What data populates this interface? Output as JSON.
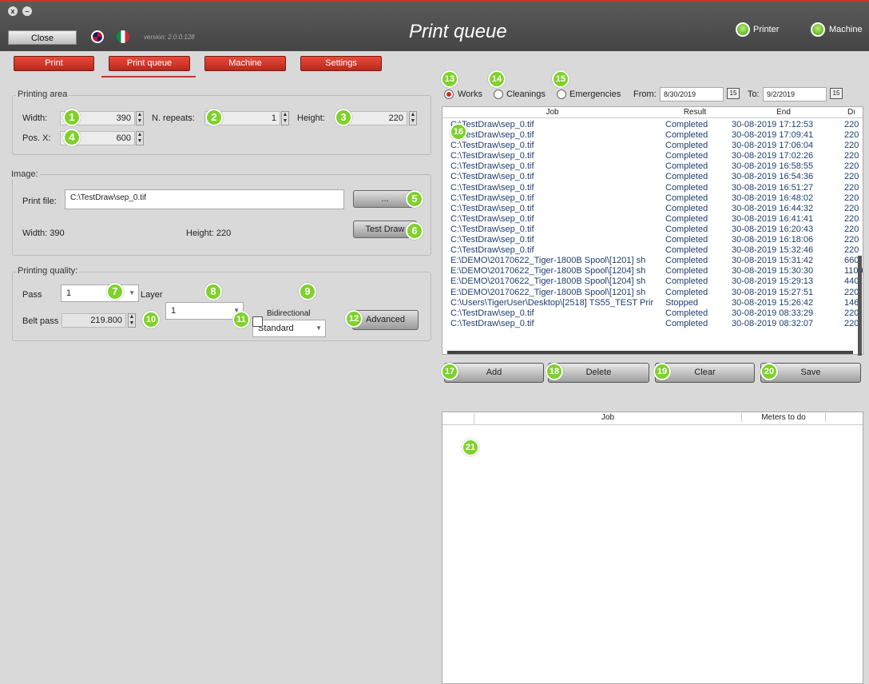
{
  "window": {
    "title": "Print queue",
    "version": "version: 2.0.0.128",
    "close_label": "Close",
    "win_close_glyph": "x",
    "win_min_glyph": "–"
  },
  "status": {
    "printer_label": "Printer",
    "machine_label": "Machine",
    "ok_color": "#7fd12b"
  },
  "nav": {
    "tabs": [
      {
        "label": "Print"
      },
      {
        "label": "Print queue"
      },
      {
        "label": "Machine"
      },
      {
        "label": "Settings"
      }
    ],
    "active": "Print queue"
  },
  "printing_area": {
    "title": "Printing area",
    "width_label": "Width:",
    "width_value": "390",
    "repeats_label": "N. repeats:",
    "repeats_value": "1",
    "height_label": "Height:",
    "height_value": "220",
    "posx_label": "Pos. X:",
    "posx_value": "600"
  },
  "image": {
    "title": "Image:",
    "print_file_label": "Print file:",
    "print_file_value": "C:\\TestDraw\\sep_0.tif",
    "browse_label": "...",
    "width_label": "Width: 390",
    "height_label": "Height: 220",
    "test_draw_label": "Test Draw"
  },
  "quality": {
    "title": "Printing quality:",
    "pass_label": "Pass",
    "pass_value": "1",
    "layer_label": "Layer",
    "layer_value": "1",
    "mode_value": "Standard",
    "belt_label": "Belt pass",
    "belt_value": "219.800",
    "bidir_label": "Bidirectional",
    "advanced_label": "Advanced"
  },
  "filter": {
    "works": "Works",
    "cleanings": "Cleanings",
    "emergencies": "Emergencies",
    "from_label": "From:",
    "from_value": "8/30/2019",
    "to_label": "To:",
    "to_value": "9/2/2019",
    "cal_glyph": "15"
  },
  "jobs": {
    "headers": [
      "Job",
      "Result",
      "End",
      "Dı"
    ],
    "rows": [
      [
        "C:\\TestDraw\\sep_0.tif",
        "Completed",
        "30-08-2019 17:12:53",
        "220"
      ],
      [
        "C:\\TestDraw\\sep_0.tif",
        "Completed",
        "30-08-2019 17:09:41",
        "220"
      ],
      [
        "C:\\TestDraw\\sep_0.tif",
        "Completed",
        "30-08-2019 17:06:04",
        "220"
      ],
      [
        "C:\\TestDraw\\sep_0.tif",
        "Completed",
        "30-08-2019 17:02:26",
        "220"
      ],
      [
        "C:\\TestDraw\\sep_0.tif",
        "Completed",
        "30-08-2019 16:58:55",
        "220"
      ],
      [
        "C:\\TestDraw\\sep_0.tif",
        "Completed",
        "30-08-2019 16:54:36",
        "220"
      ],
      [
        "C:\\TestDraw\\sep_0.tif",
        "Completed",
        "30-08-2019 16:51:27",
        "220"
      ],
      [
        "C:\\TestDraw\\sep_0.tif",
        "Completed",
        "30-08-2019 16:48:02",
        "220"
      ],
      [
        "C:\\TestDraw\\sep_0.tif",
        "Completed",
        "30-08-2019 16:44:32",
        "220"
      ],
      [
        "C:\\TestDraw\\sep_0.tif",
        "Completed",
        "30-08-2019 16:41:41",
        "220"
      ],
      [
        "C:\\TestDraw\\sep_0.tif",
        "Completed",
        "30-08-2019 16:20:43",
        "220"
      ],
      [
        "C:\\TestDraw\\sep_0.tif",
        "Completed",
        "30-08-2019 16:18:06",
        "220"
      ],
      [
        "C:\\TestDraw\\sep_0.tif",
        "Completed",
        "30-08-2019 15:32:46",
        "220"
      ],
      [
        "E:\\DEMO\\20170622_Tiger-1800B Spool\\[1201] sh",
        "Completed",
        "30-08-2019 15:31:42",
        "660"
      ],
      [
        "E:\\DEMO\\20170622_Tiger-1800B Spool\\[1204] sh",
        "Completed",
        "30-08-2019 15:30:30",
        "1100"
      ],
      [
        "E:\\DEMO\\20170622_Tiger-1800B Spool\\[1204] sh",
        "Completed",
        "30-08-2019 15:29:13",
        "440"
      ],
      [
        "E:\\DEMO\\20170622_Tiger-1800B Spool\\[1201] sh",
        "Completed",
        "30-08-2019 15:27:51",
        "220"
      ],
      [
        "C:\\Users\\TigerUser\\Desktop\\[2518] TS55_TEST Prir",
        "Stopped",
        "30-08-2019 15:26:42",
        "146"
      ],
      [
        "C:\\TestDraw\\sep_0.tif",
        "Completed",
        "30-08-2019 08:33:29",
        "220"
      ],
      [
        "C:\\TestDraw\\sep_0.tif",
        "Completed",
        "30-08-2019 08:32:07",
        "220"
      ]
    ]
  },
  "actions": {
    "add": "Add",
    "delete": "Delete",
    "clear": "Clear",
    "save": "Save"
  },
  "todo": {
    "headers": [
      "Job",
      "Meters to do"
    ]
  },
  "badges": [
    "1",
    "2",
    "3",
    "4",
    "5",
    "6",
    "7",
    "8",
    "9",
    "10",
    "11",
    "12",
    "13",
    "14",
    "15",
    "16",
    "17",
    "18",
    "19",
    "20",
    "21"
  ]
}
